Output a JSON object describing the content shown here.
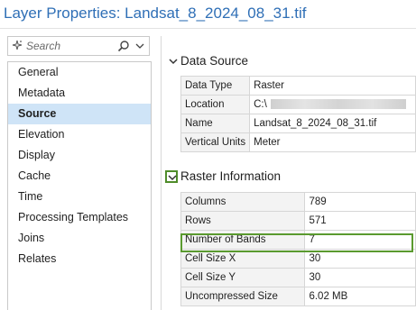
{
  "window": {
    "title": "Layer Properties: Landsat_8_2024_08_31.tif"
  },
  "search": {
    "placeholder": "Search"
  },
  "nav": {
    "items": [
      {
        "label": "General",
        "selected": false
      },
      {
        "label": "Metadata",
        "selected": false
      },
      {
        "label": "Source",
        "selected": true
      },
      {
        "label": "Elevation",
        "selected": false
      },
      {
        "label": "Display",
        "selected": false
      },
      {
        "label": "Cache",
        "selected": false
      },
      {
        "label": "Time",
        "selected": false
      },
      {
        "label": "Processing Templates",
        "selected": false
      },
      {
        "label": "Joins",
        "selected": false
      },
      {
        "label": "Relates",
        "selected": false
      }
    ]
  },
  "data_source": {
    "header": "Data Source",
    "rows": [
      {
        "key": "Data Type",
        "value": "Raster"
      },
      {
        "key": "Location",
        "value": "C:\\"
      },
      {
        "key": "Name",
        "value": "Landsat_8_2024_08_31.tif"
      },
      {
        "key": "Vertical Units",
        "value": "Meter"
      }
    ]
  },
  "raster_info": {
    "header": "Raster Information",
    "rows": [
      {
        "key": "Columns",
        "value": "789"
      },
      {
        "key": "Rows",
        "value": "571"
      },
      {
        "key": "Number of Bands",
        "value": "7"
      },
      {
        "key": "Cell Size X",
        "value": "30"
      },
      {
        "key": "Cell Size Y",
        "value": "30"
      },
      {
        "key": "Uncompressed Size",
        "value": "6.02 MB"
      }
    ]
  },
  "colors": {
    "title": "#2f6fb6",
    "selected_nav": "#cfe4f7",
    "highlight": "#5a9a2f"
  }
}
